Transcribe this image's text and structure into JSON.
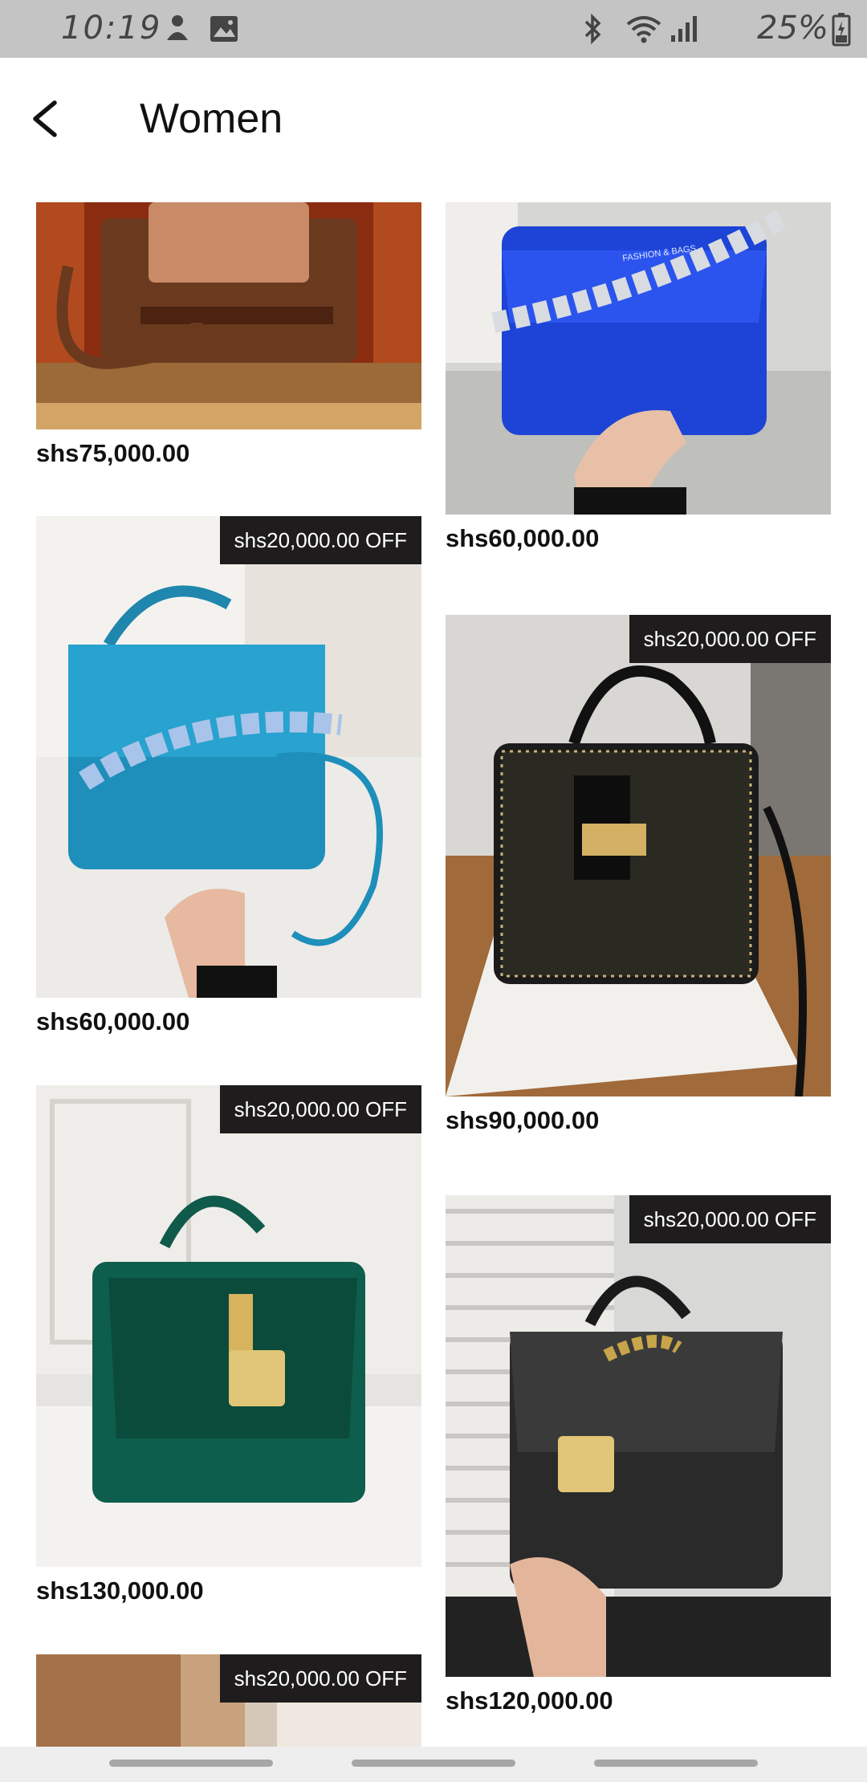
{
  "status_bar": {
    "time": "10:19",
    "battery": "25%",
    "icons": [
      "notification-icon",
      "gallery-icon",
      "bluetooth-icon",
      "wifi-icon",
      "signal-icon",
      "battery-icon"
    ]
  },
  "header": {
    "title": "Women",
    "back_icon": "chevron-left-icon"
  },
  "products": [
    {
      "price": "shs75,000.00",
      "discount": "",
      "image": "brown-leather-bag"
    },
    {
      "price": "shs60,000.00",
      "discount": "",
      "image": "blue-chain-bag",
      "image_text": "FASHION & BAGS"
    },
    {
      "price": "shs60,000.00",
      "discount": "shs20,000.00 OFF",
      "image": "teal-quilted-bag"
    },
    {
      "price": "shs90,000.00",
      "discount": "shs20,000.00 OFF",
      "image": "black-tweed-bag"
    },
    {
      "price": "shs130,000.00",
      "discount": "shs20,000.00 OFF",
      "image": "green-velvet-bag"
    },
    {
      "price": "shs120,000.00",
      "discount": "shs20,000.00 OFF",
      "image": "black-croc-bag"
    },
    {
      "price": "",
      "discount": "shs20,000.00 OFF",
      "image": "tan-coat-bag"
    }
  ],
  "colors": {
    "status_bar": "#c4c4c4",
    "badge_bg": "#1f1c1d",
    "text": "#111111"
  }
}
